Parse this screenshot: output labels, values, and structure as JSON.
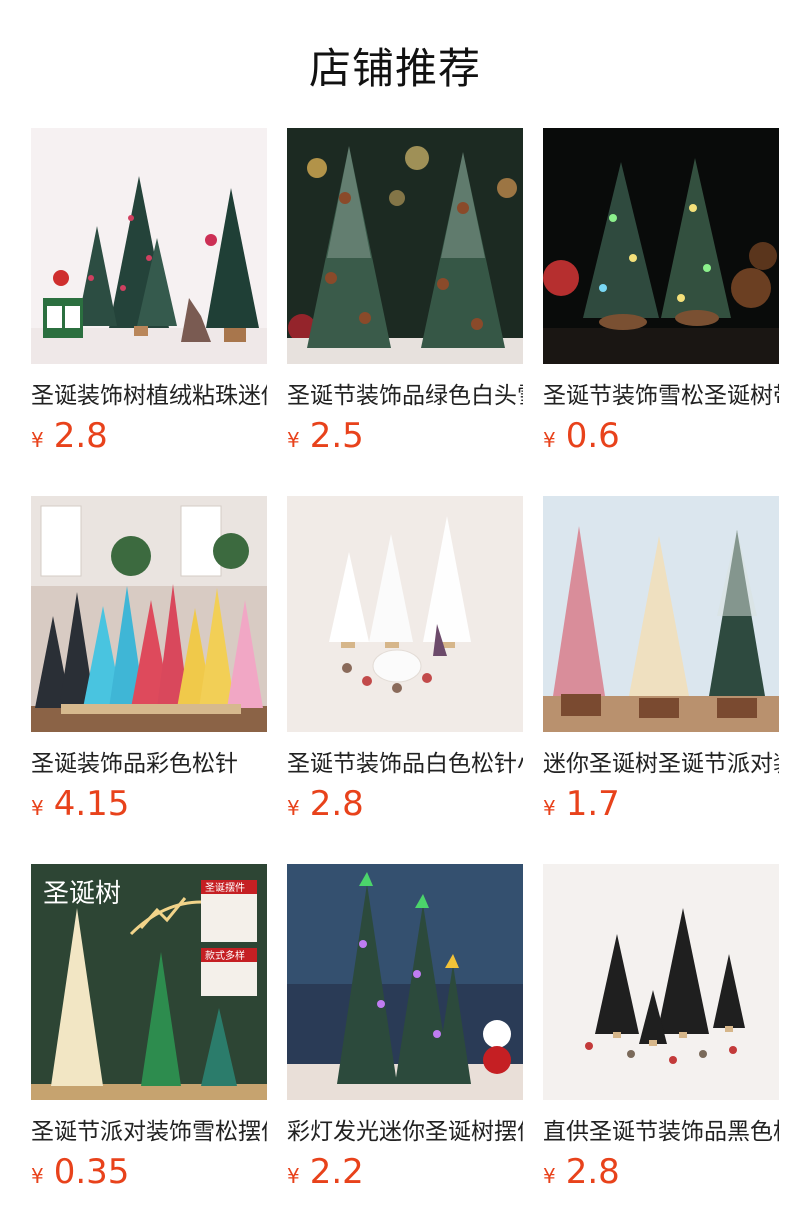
{
  "page": {
    "title": "店铺推荐"
  },
  "colors": {
    "price": "#e8421b",
    "text": "#222222"
  },
  "products": [
    {
      "title": "圣诞装饰树植绒粘珠迷你小",
      "currency": "¥",
      "price": "2.8"
    },
    {
      "title": "圣诞节装饰品绿色白头雪松",
      "currency": "¥",
      "price": "2.5"
    },
    {
      "title": "圣诞节装饰雪松圣诞树带灯",
      "currency": "¥",
      "price": "0.6"
    },
    {
      "title": "圣诞装饰品彩色松针",
      "currency": "¥",
      "price": "4.15"
    },
    {
      "title": "圣诞节装饰品白色松针小树",
      "currency": "¥",
      "price": "2.8"
    },
    {
      "title": "迷你圣诞树圣诞节派对装饰",
      "currency": "¥",
      "price": "1.7"
    },
    {
      "title": "圣诞节派对装饰雪松摆件",
      "currency": "¥",
      "price": "0.35",
      "image_text": {
        "banner": "圣诞树",
        "tag1": "圣诞摆件",
        "tag2": "款式多样"
      }
    },
    {
      "title": "彩灯发光迷你圣诞树摆件",
      "currency": "¥",
      "price": "2.2"
    },
    {
      "title": "直供圣诞节装饰品黑色松针",
      "currency": "¥",
      "price": "2.8"
    }
  ]
}
